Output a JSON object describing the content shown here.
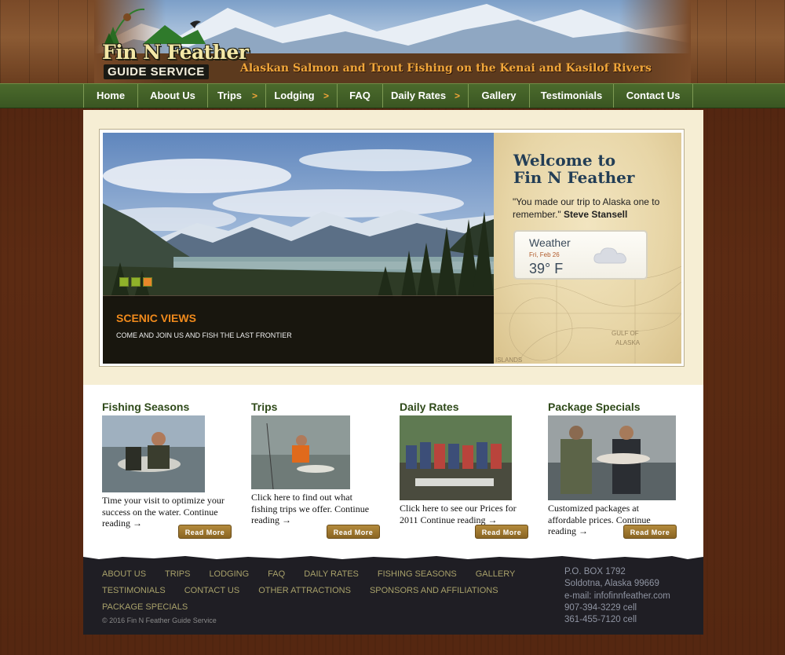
{
  "header": {
    "logo_line1": "Fin N Feather",
    "logo_line2": "GUIDE SERVICE",
    "tagline": "Alaskan Salmon and Trout Fishing on the Kenai and Kasilof Rivers"
  },
  "nav": [
    {
      "label": "Home",
      "has_submenu": false
    },
    {
      "label": "About Us",
      "has_submenu": false
    },
    {
      "label": "Trips",
      "has_submenu": true
    },
    {
      "label": "Lodging",
      "has_submenu": true
    },
    {
      "label": "FAQ",
      "has_submenu": false
    },
    {
      "label": "Daily Rates",
      "has_submenu": true
    },
    {
      "label": "Gallery",
      "has_submenu": false
    },
    {
      "label": "Testimonials",
      "has_submenu": false
    },
    {
      "label": "Contact Us",
      "has_submenu": false
    }
  ],
  "nav_arrow": ">",
  "slider": {
    "caption_title": "SCENIC VIEWS",
    "caption_sub": "COME AND JOIN US AND FISH THE LAST FRONTIER",
    "slide_count": 3,
    "active_slide": 3
  },
  "welcome": {
    "title_line1": "Welcome to",
    "title_line2": "Fin N Feather",
    "quote": "\"You made our trip to Alaska one to remember.\"",
    "author": "Steve Stansell",
    "map_label_1": "GULF OF",
    "map_label_2": "ALASKA",
    "map_label_3": "ISLANDS"
  },
  "weather": {
    "title": "Weather",
    "date": "Fri, Feb 26",
    "temp": "39° F",
    "icon": "cloud-icon"
  },
  "features": [
    {
      "title": "Fishing Seasons",
      "text": "Time your visit to optimize your success on the water. Continue reading →",
      "button": "Read More"
    },
    {
      "title": "Trips",
      "text": "Click here to find out what fishing trips we offer. Continue reading →",
      "button": "Read More"
    },
    {
      "title": "Daily Rates",
      "text": "Click here to see our Prices for 2011 Continue reading →",
      "button": "Read More"
    },
    {
      "title": "Package Specials",
      "text": "Customized packages at affordable prices. Continue reading →",
      "button": "Read More"
    }
  ],
  "footer": {
    "links_row1": [
      "ABOUT US",
      "TRIPS",
      "LODGING",
      "FAQ",
      "DAILY RATES",
      "FISHING SEASONS",
      "GALLERY"
    ],
    "links_row2": [
      "TESTIMONIALS",
      "CONTACT US",
      "OTHER ATTRACTIONS",
      "SPONSORS AND AFFILIATIONS"
    ],
    "links_row3": [
      "PACKAGE SPECIALS"
    ],
    "copyright": "© 2016 Fin N Feather Guide Service",
    "address": [
      "P.O. BOX 1792",
      "Soldotna, Alaska 99669",
      "e-mail: infofinnfeather.com",
      "907-394-3229 cell",
      "361-455-7120 cell"
    ]
  },
  "colors": {
    "nav_green": "#4b6a2c",
    "accent_orange": "#f0a63a",
    "caption_orange": "#f08a1c",
    "title_blue": "#233e56",
    "footer_bg": "#1f1e24",
    "dot_inactive": "#8fb22a",
    "dot_active": "#e8872a"
  }
}
